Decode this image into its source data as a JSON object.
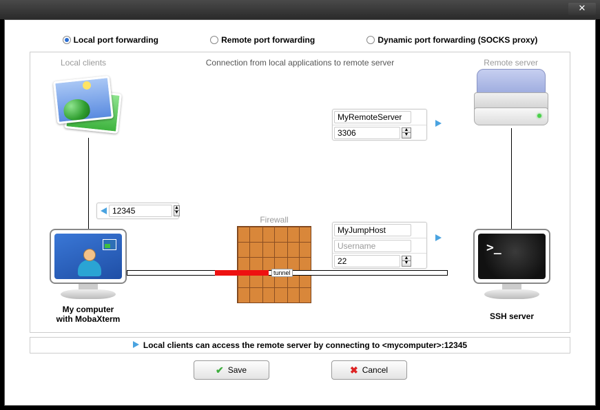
{
  "radios": {
    "local": "Local port forwarding",
    "remote": "Remote port forwarding",
    "dynamic": "Dynamic port forwarding (SOCKS proxy)",
    "selected": "local"
  },
  "subtitle": "Connection from local applications to remote server",
  "labels": {
    "local_clients": "Local clients",
    "remote_server": "Remote server",
    "firewall": "Firewall",
    "tunnel": "tunnel",
    "my_computer_l1": "My computer",
    "my_computer_l2": "with MobaXterm",
    "ssh_server": "SSH server"
  },
  "local": {
    "port": "12345"
  },
  "remote": {
    "host": "MyRemoteServer",
    "port": "3306"
  },
  "ssh": {
    "host": "MyJumpHost",
    "user_placeholder": "Username",
    "user": "",
    "port": "22"
  },
  "hint": "Local clients can access the remote server by connecting to <mycomputer>:12345",
  "buttons": {
    "save": "Save",
    "cancel": "Cancel"
  }
}
